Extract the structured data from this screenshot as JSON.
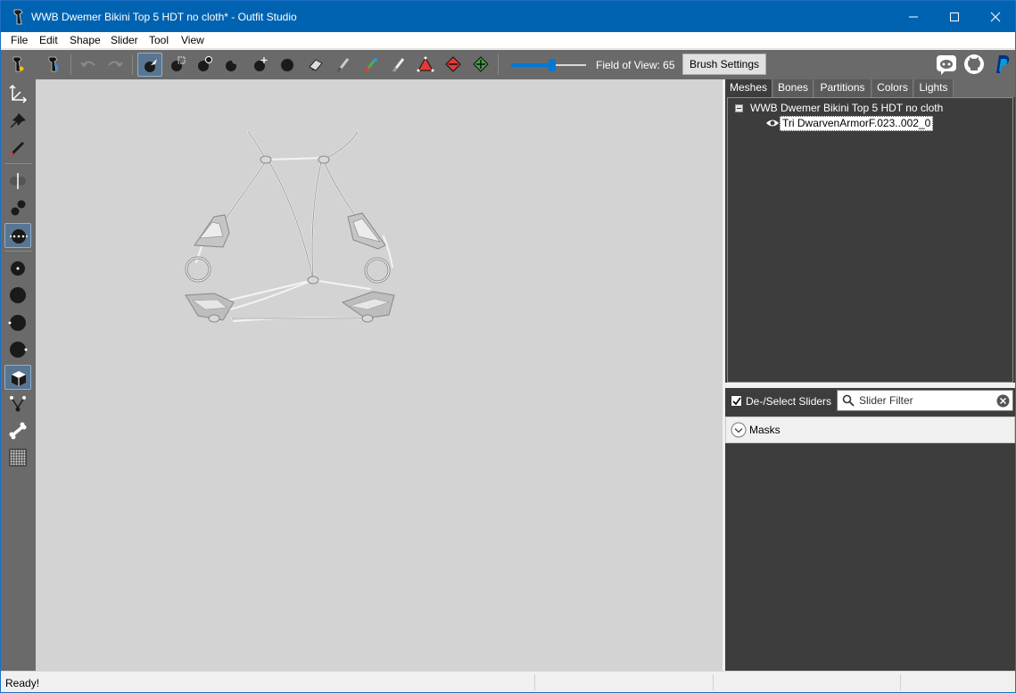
{
  "window": {
    "title": "WWB Dwemer Bikini Top 5 HDT no cloth* - Outfit Studio",
    "controls": [
      "minimize-icon",
      "maximize-icon",
      "close-icon"
    ],
    "title_bar_color": "#0063b1"
  },
  "menu": {
    "items": [
      "File",
      "Edit",
      "Shape",
      "Slider",
      "Tool",
      "View"
    ]
  },
  "toolbar": {
    "icons": [
      "reference-icon",
      "outfit-icon",
      "undo-icon",
      "redo-icon",
      "select-icon",
      "transform-icon",
      "mask-brush-icon",
      "inflate-brush-icon",
      "deflate-brush-icon",
      "move-brush-icon",
      "smooth-brush-icon",
      "undiff-brush-icon",
      "weight-brush-icon",
      "color-brush-icon",
      "alpha-brush-icon",
      "collapse-vertex-icon",
      "flip-edge-icon",
      "split-edge-icon"
    ],
    "fov_label": "Field of View: 65",
    "fov_value": 65,
    "fov_min": 0,
    "fov_max": 120,
    "brush_settings_label": "Brush Settings",
    "social_icons": [
      "discord-icon",
      "github-icon",
      "paypal-icon"
    ]
  },
  "left_tools": {
    "icons": [
      "transform-tool-icon",
      "pivot-tool-icon",
      "vertex-edit-icon",
      "xmirror-icon",
      "connected-only-icon",
      "select-points-icon",
      "brush-size-small-icon",
      "brush-size-large-icon",
      "brush-falloff-icon",
      "brush-strength-icon",
      "wireframe-icon",
      "show-vertices-icon",
      "show-bones-icon",
      "grid-icon"
    ]
  },
  "panel": {
    "tabs": [
      "Meshes",
      "Bones",
      "Partitions",
      "Colors",
      "Lights"
    ],
    "active_tab": "Meshes",
    "tree": {
      "root": "WWB Dwemer Bikini Top 5 HDT no cloth",
      "child": "Tri DwarvenArmorF.023..002_0"
    },
    "sliders_checkbox_label": "De-/Select Sliders",
    "slider_filter_placeholder": "Slider Filter",
    "masks_label": "Masks"
  },
  "status": {
    "text": "Ready!"
  }
}
